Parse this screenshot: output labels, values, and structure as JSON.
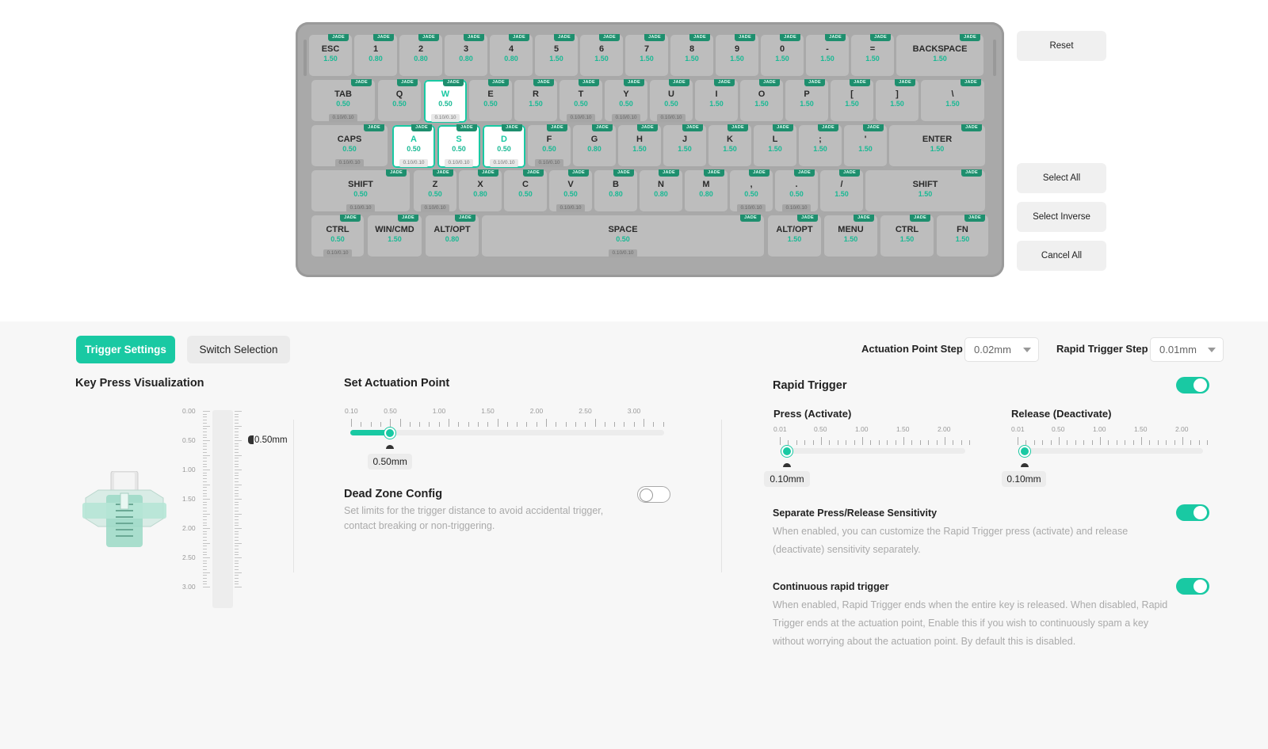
{
  "keyboard": {
    "tag": "JADE",
    "rows": [
      [
        {
          "label": "ESC",
          "value": "1.50",
          "rt": ""
        },
        {
          "label": "1",
          "value": "0.80",
          "rt": ""
        },
        {
          "label": "2",
          "value": "0.80",
          "rt": ""
        },
        {
          "label": "3",
          "value": "0.80",
          "rt": ""
        },
        {
          "label": "4",
          "value": "0.80",
          "rt": ""
        },
        {
          "label": "5",
          "value": "1.50",
          "rt": ""
        },
        {
          "label": "6",
          "value": "1.50",
          "rt": ""
        },
        {
          "label": "7",
          "value": "1.50",
          "rt": ""
        },
        {
          "label": "8",
          "value": "1.50",
          "rt": ""
        },
        {
          "label": "9",
          "value": "1.50",
          "rt": ""
        },
        {
          "label": "0",
          "value": "1.50",
          "rt": ""
        },
        {
          "label": "-",
          "value": "1.50",
          "rt": ""
        },
        {
          "label": "=",
          "value": "1.50",
          "rt": ""
        },
        {
          "label": "BACKSPACE",
          "value": "1.50",
          "rt": ""
        }
      ],
      [
        {
          "label": "TAB",
          "value": "0.50",
          "rt": "0.10/0.10"
        },
        {
          "label": "Q",
          "value": "0.50",
          "rt": ""
        },
        {
          "label": "W",
          "value": "0.50",
          "rt": "0.10/0.10",
          "selected": true
        },
        {
          "label": "E",
          "value": "0.50",
          "rt": ""
        },
        {
          "label": "R",
          "value": "1.50",
          "rt": ""
        },
        {
          "label": "T",
          "value": "0.50",
          "rt": "0.10/0.10"
        },
        {
          "label": "Y",
          "value": "0.50",
          "rt": "0.10/0.10"
        },
        {
          "label": "U",
          "value": "0.50",
          "rt": "0.10/0.10"
        },
        {
          "label": "I",
          "value": "1.50",
          "rt": ""
        },
        {
          "label": "O",
          "value": "1.50",
          "rt": ""
        },
        {
          "label": "P",
          "value": "1.50",
          "rt": ""
        },
        {
          "label": "[",
          "value": "1.50",
          "rt": ""
        },
        {
          "label": "]",
          "value": "1.50",
          "rt": ""
        },
        {
          "label": "\\",
          "value": "1.50",
          "rt": ""
        }
      ],
      [
        {
          "label": "CAPS",
          "value": "0.50",
          "rt": "0.10/0.10"
        },
        {
          "label": "A",
          "value": "0.50",
          "rt": "0.10/0.10",
          "selected": true
        },
        {
          "label": "S",
          "value": "0.50",
          "rt": "0.10/0.10",
          "selected": true
        },
        {
          "label": "D",
          "value": "0.50",
          "rt": "0.10/0.10",
          "selected": true
        },
        {
          "label": "F",
          "value": "0.50",
          "rt": "0.10/0.10"
        },
        {
          "label": "G",
          "value": "0.80",
          "rt": ""
        },
        {
          "label": "H",
          "value": "1.50",
          "rt": ""
        },
        {
          "label": "J",
          "value": "1.50",
          "rt": ""
        },
        {
          "label": "K",
          "value": "1.50",
          "rt": ""
        },
        {
          "label": "L",
          "value": "1.50",
          "rt": ""
        },
        {
          "label": ";",
          "value": "1.50",
          "rt": ""
        },
        {
          "label": "'",
          "value": "1.50",
          "rt": ""
        },
        {
          "label": "ENTER",
          "value": "1.50",
          "rt": ""
        }
      ],
      [
        {
          "label": "SHIFT",
          "value": "0.50",
          "rt": "0.10/0.10"
        },
        {
          "label": "Z",
          "value": "0.50",
          "rt": "0.10/0.10"
        },
        {
          "label": "X",
          "value": "0.80",
          "rt": ""
        },
        {
          "label": "C",
          "value": "0.50",
          "rt": ""
        },
        {
          "label": "V",
          "value": "0.50",
          "rt": "0.10/0.10"
        },
        {
          "label": "B",
          "value": "0.80",
          "rt": ""
        },
        {
          "label": "N",
          "value": "0.80",
          "rt": ""
        },
        {
          "label": "M",
          "value": "0.80",
          "rt": ""
        },
        {
          "label": ",",
          "value": "0.50",
          "rt": "0.10/0.10"
        },
        {
          "label": ".",
          "value": "0.50",
          "rt": "0.10/0.10"
        },
        {
          "label": "/",
          "value": "1.50",
          "rt": ""
        },
        {
          "label": "SHIFT",
          "value": "1.50",
          "rt": ""
        }
      ],
      [
        {
          "label": "CTRL",
          "value": "0.50",
          "rt": "0.10/0.10"
        },
        {
          "label": "WIN/CMD",
          "value": "1.50",
          "rt": ""
        },
        {
          "label": "ALT/OPT",
          "value": "0.80",
          "rt": ""
        },
        {
          "label": "SPACE",
          "value": "0.50",
          "rt": "0.10/0.10"
        },
        {
          "label": "ALT/OPT",
          "value": "1.50",
          "rt": ""
        },
        {
          "label": "MENU",
          "value": "1.50",
          "rt": ""
        },
        {
          "label": "CTRL",
          "value": "1.50",
          "rt": ""
        },
        {
          "label": "FN",
          "value": "1.50",
          "rt": ""
        }
      ]
    ]
  },
  "side_buttons": {
    "reset": "Reset",
    "select_all": "Select All",
    "select_inverse": "Select Inverse",
    "cancel_all": "Cancel All"
  },
  "tabs": {
    "trigger": "Trigger Settings",
    "switch": "Switch Selection"
  },
  "steps": {
    "actuation_label": "Actuation Point Step",
    "actuation_value": "0.02mm",
    "rapid_label": "Rapid Trigger Step",
    "rapid_value": "0.01mm"
  },
  "visualization": {
    "title": "Key Press Visualization",
    "ticks": [
      "0.00",
      "0.50",
      "1.00",
      "1.50",
      "2.00",
      "2.50",
      "3.00"
    ],
    "current": "0.50mm"
  },
  "actuation": {
    "title": "Set Actuation Point",
    "ticks": [
      "0.10",
      "0.50",
      "1.00",
      "1.50",
      "2.00",
      "2.50",
      "3.00"
    ],
    "value": "0.50mm",
    "fraction": 0.14
  },
  "deadzone": {
    "title": "Dead Zone Config",
    "desc_line1": "Set limits for the trigger distance to avoid accidental trigger,",
    "desc_line2": "contact breaking or non-triggering.",
    "enabled": false
  },
  "rapid": {
    "title": "Rapid Trigger",
    "enabled": true,
    "press_label": "Press (Activate)",
    "release_label": "Release (Deactivate)",
    "ticks": [
      "0.01",
      "0.50",
      "1.00",
      "1.50",
      "2.00"
    ],
    "press_value": "0.10mm",
    "release_value": "0.10mm"
  },
  "separate": {
    "title": "Separate Press/Release Sensitivity",
    "enabled": true,
    "desc_line1": "When enabled, you can customize the Rapid Trigger press (activate) and release",
    "desc_line2": "(deactivate) sensitivity separately."
  },
  "continuous": {
    "title": "Continuous rapid trigger",
    "enabled": true,
    "desc_line1": "When enabled, Rapid Trigger ends when the entire key is released. When disabled, Rapid",
    "desc_line2": "Trigger ends at the actuation point, Enable this if you wish to continuously spam a key",
    "desc_line3": "without worrying about the actuation point. By default this is disabled."
  },
  "colors": {
    "accent": "#19c9a3",
    "tag": "#1e8f6e"
  }
}
